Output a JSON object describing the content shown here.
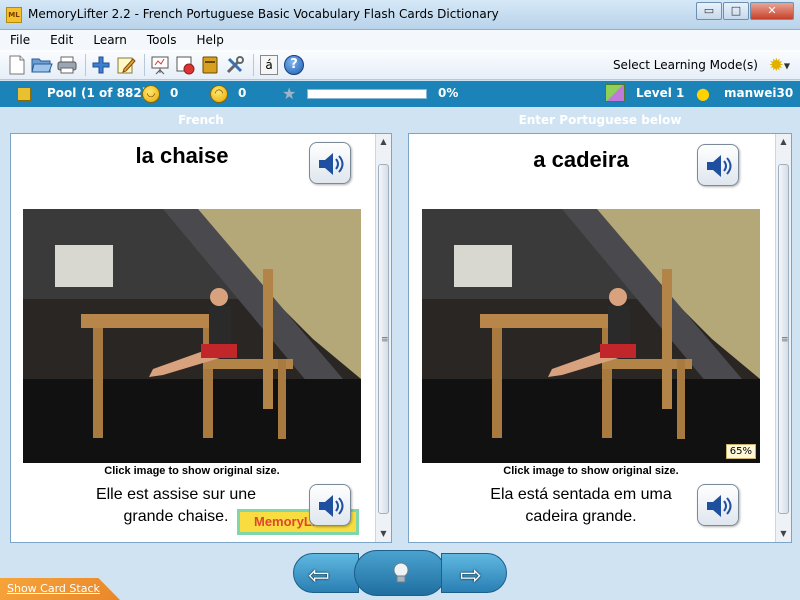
{
  "window": {
    "title": "MemoryLifter 2.2 - French Portuguese Basic Vocabulary Flash Cards Dictionary",
    "app_icon_text": "ML",
    "minimize": "▭",
    "maximize": "□",
    "close": "✕"
  },
  "menu": [
    "File",
    "Edit",
    "Learn",
    "Tools",
    "Help"
  ],
  "toolbar": {
    "icons": [
      "new-icon",
      "open-icon",
      "print-icon",
      "add-card-icon",
      "edit-icon",
      "presentation-icon",
      "slideshow-icon",
      "dictionary-icon",
      "tools-icon",
      "accent-icon",
      "help-icon"
    ],
    "accent_glyph": "á",
    "help_glyph": "?",
    "learning_mode_label": "Select Learning Mode(s)"
  },
  "status": {
    "pool_label": "Pool",
    "pool_count": "(1 of 882)",
    "happy_count": "0",
    "sad_count": "0",
    "progress_fraction": 0,
    "progress_text": "0%",
    "level": "Level 1",
    "user": "manwei30"
  },
  "left": {
    "header": "French",
    "word": "la chaise",
    "caption": "Click image to show original size.",
    "sentence_line1": "Elle est assise sur une",
    "sentence_line2": "grande chaise.",
    "logo_text": "MemoryLifter"
  },
  "right": {
    "header": "Enter Portuguese below",
    "word": "a cadeira",
    "caption": "Click image to show original size.",
    "sentence_line1": "Ela está sentada em uma",
    "sentence_line2": "cadeira grande.",
    "zoom": "65%"
  },
  "nav": {
    "back_glyph": "⇦",
    "next_glyph": "⇨",
    "hint_glyph": "💡"
  },
  "footer": {
    "show_card_stack": "Show Card Stack"
  },
  "colors": {
    "status_bar": "#1b83b8",
    "panel_border": "#7ba4c6",
    "background": "#cfe3f3"
  }
}
